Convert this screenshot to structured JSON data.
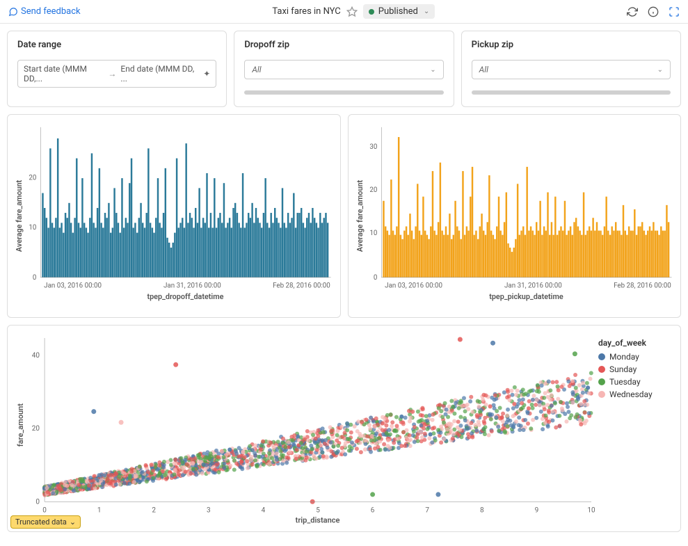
{
  "header": {
    "feedback": "Send feedback",
    "title": "Taxi fares in NYC",
    "status_label": "Published"
  },
  "filters": {
    "date_range": {
      "label": "Date range",
      "start_placeholder": "Start date (MMM DD,...",
      "end_placeholder": "End date (MMM DD, ..."
    },
    "dropoff_zip": {
      "label": "Dropoff zip",
      "value": "All"
    },
    "pickup_zip": {
      "label": "Pickup zip",
      "value": "All"
    }
  },
  "truncated_label": "Truncated data",
  "legend": {
    "title": "day_of_week",
    "items": [
      {
        "label": "Monday",
        "color": "#4c78a8"
      },
      {
        "label": "Sunday",
        "color": "#e45756"
      },
      {
        "label": "Tuesday",
        "color": "#54a24b"
      },
      {
        "label": "Wednesday",
        "color": "#f7b6b4"
      }
    ]
  },
  "chart_data": [
    {
      "type": "bar",
      "title": "",
      "xlabel": "tpep_dropoff_datetime",
      "ylabel": "Average fare_amount",
      "ylim": [
        0,
        30
      ],
      "xticks": [
        "Jan 03, 2016 00:00",
        "Jan 31, 2016 00:00",
        "Feb 28, 2016 00:00"
      ],
      "yticks": [
        0,
        10,
        20
      ],
      "color": "#2b7a99",
      "note": "Dense hourly series; values sampled per visual estimate",
      "values": [
        17,
        14,
        12,
        10,
        26,
        11,
        10,
        12,
        28,
        10,
        11,
        9,
        13,
        12,
        15,
        11,
        9,
        12,
        24,
        11,
        10,
        20,
        11,
        10,
        9,
        12,
        25,
        11,
        10,
        14,
        22,
        11,
        10,
        13,
        12,
        15,
        9,
        10,
        18,
        13,
        11,
        9,
        20,
        10,
        12,
        11,
        19,
        24,
        10,
        11,
        9,
        12,
        15,
        11,
        10,
        13,
        26,
        11,
        10,
        9,
        12,
        20,
        11,
        10,
        13,
        22,
        8,
        7,
        6,
        7,
        9,
        24,
        10,
        11,
        12,
        10,
        27,
        11,
        13,
        12,
        10,
        14,
        11,
        18,
        10,
        12,
        11,
        21,
        10,
        13,
        10,
        20,
        10,
        12,
        13,
        11,
        19,
        10,
        11,
        12,
        10,
        14,
        15,
        13,
        11,
        10,
        21,
        10,
        11,
        13,
        12,
        15,
        11,
        14,
        12,
        11,
        10,
        13,
        20,
        11,
        10,
        13,
        11,
        14,
        12,
        11,
        10,
        18,
        11,
        10,
        13,
        11,
        12,
        17,
        10,
        13,
        13,
        14,
        11,
        10,
        12,
        13,
        11,
        14,
        12,
        11,
        10,
        13,
        11,
        12,
        13,
        11
      ]
    },
    {
      "type": "bar",
      "title": "",
      "xlabel": "tpep_pickup_datetime",
      "ylabel": "Average fare_amount",
      "ylim": [
        0,
        35
      ],
      "xticks": [
        "Jan 03, 2016 00:00",
        "Jan 31, 2016 00:00",
        "Feb 28, 2016 00:00"
      ],
      "yticks": [
        0,
        10,
        20,
        30
      ],
      "color": "#f2a31b",
      "note": "Dense hourly series; values sampled per visual estimate",
      "values": [
        18,
        12,
        11,
        10,
        23,
        11,
        10,
        12,
        33,
        10,
        9,
        11,
        12,
        10,
        15,
        11,
        9,
        12,
        22,
        11,
        10,
        19,
        11,
        10,
        9,
        12,
        25,
        11,
        10,
        13,
        27,
        11,
        10,
        12,
        10,
        15,
        9,
        10,
        18,
        12,
        11,
        9,
        25,
        10,
        12,
        11,
        19,
        26,
        10,
        11,
        9,
        12,
        15,
        11,
        10,
        13,
        24,
        11,
        10,
        9,
        12,
        19,
        11,
        10,
        13,
        20,
        8,
        7,
        6,
        7,
        9,
        22,
        10,
        11,
        12,
        10,
        26,
        11,
        12,
        11,
        10,
        13,
        11,
        18,
        10,
        12,
        11,
        20,
        10,
        13,
        10,
        19,
        10,
        11,
        12,
        11,
        18,
        10,
        11,
        12,
        10,
        13,
        14,
        12,
        11,
        10,
        20,
        10,
        11,
        12,
        11,
        14,
        11,
        13,
        11,
        11,
        10,
        12,
        19,
        11,
        10,
        12,
        11,
        13,
        11,
        11,
        10,
        17,
        11,
        10,
        12,
        11,
        11,
        16,
        10,
        12,
        12,
        13,
        11,
        10,
        11,
        12,
        11,
        13,
        11,
        11,
        10,
        12,
        11,
        11,
        17,
        13
      ]
    },
    {
      "type": "scatter",
      "title": "",
      "xlabel": "trip_distance",
      "ylabel": "fare_amount",
      "xlim": [
        0,
        10
      ],
      "ylim": [
        0,
        45
      ],
      "xticks": [
        0,
        1,
        2,
        3,
        4,
        5,
        6,
        7,
        8,
        9,
        10
      ],
      "yticks": [
        0,
        20,
        40
      ],
      "legend_title": "day_of_week",
      "series": [
        {
          "name": "Monday",
          "color": "#4c78a8"
        },
        {
          "name": "Sunday",
          "color": "#e45756"
        },
        {
          "name": "Tuesday",
          "color": "#54a24b"
        },
        {
          "name": "Wednesday",
          "color": "#f7b6b4"
        }
      ],
      "note": "Dense cloud; fare_amount ≈ 3 + 2.6·trip_distance with spread; a few outliers at (2.4,38),(4.9,0),(6,2),(7.2,2),(7.6,45),(8.2,44),(9.7,41)"
    }
  ]
}
